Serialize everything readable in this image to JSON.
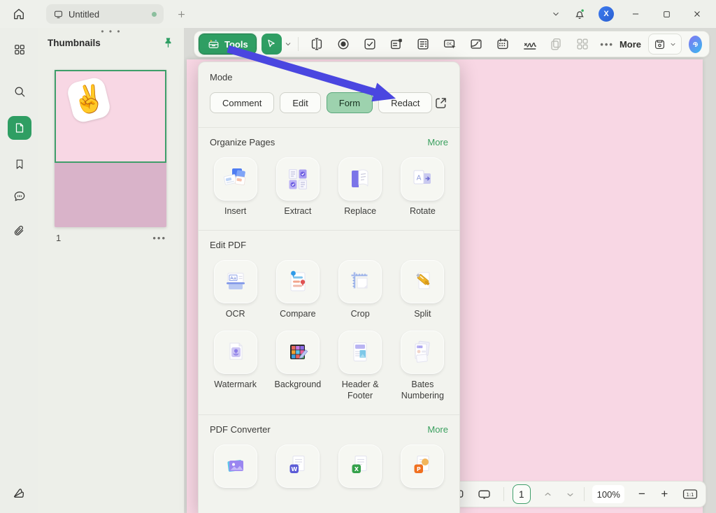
{
  "window": {
    "tab_title": "Untitled",
    "avatar_initial": "X"
  },
  "toolbar": {
    "tools_button_label": "Tools",
    "more_button_label": "More",
    "form_tools": [
      {
        "icon": "text-field-icon",
        "enabled": true
      },
      {
        "icon": "radio-button-icon",
        "enabled": true
      },
      {
        "icon": "checkbox-icon",
        "enabled": true
      },
      {
        "icon": "combo-box-icon",
        "enabled": true
      },
      {
        "icon": "list-box-icon",
        "enabled": true
      },
      {
        "icon": "push-button-icon",
        "enabled": true
      },
      {
        "icon": "image-field-icon",
        "enabled": true
      },
      {
        "icon": "date-field-icon",
        "enabled": true
      },
      {
        "icon": "signature-field-icon",
        "enabled": true
      },
      {
        "icon": "copy-icon",
        "enabled": false
      },
      {
        "icon": "grid-layout-icon",
        "enabled": false
      }
    ]
  },
  "sidebar": {
    "items": [
      {
        "icon": "grid-view-icon",
        "active": false
      },
      {
        "icon": "search-icon",
        "active": false
      },
      {
        "icon": "thumbnails-icon",
        "active": true
      },
      {
        "icon": "bookmark-icon",
        "active": false
      },
      {
        "icon": "comment-icon",
        "active": false
      },
      {
        "icon": "attachment-icon",
        "active": false
      }
    ],
    "bottom_icon": "swatches-icon"
  },
  "thumbnails": {
    "title": "Thumbnails",
    "page_number": "1"
  },
  "panel": {
    "mode": {
      "label": "Mode",
      "buttons": [
        {
          "label": "Comment",
          "active": false
        },
        {
          "label": "Edit",
          "active": false
        },
        {
          "label": "Form",
          "active": true
        },
        {
          "label": "Redact",
          "active": false
        }
      ]
    },
    "sections": [
      {
        "title": "Organize Pages",
        "more_label": "More",
        "items": [
          {
            "label": "Insert",
            "icon": "insert-icon"
          },
          {
            "label": "Extract",
            "icon": "extract-icon"
          },
          {
            "label": "Replace",
            "icon": "replace-icon"
          },
          {
            "label": "Rotate",
            "icon": "rotate-icon"
          }
        ]
      },
      {
        "title": "Edit PDF",
        "more_label": "",
        "items": [
          {
            "label": "OCR",
            "icon": "ocr-icon"
          },
          {
            "label": "Compare",
            "icon": "compare-icon"
          },
          {
            "label": "Crop",
            "icon": "crop-icon"
          },
          {
            "label": "Split",
            "icon": "split-icon"
          },
          {
            "label": "Watermark",
            "icon": "watermark-icon"
          },
          {
            "label": "Background",
            "icon": "background-icon"
          },
          {
            "label": "Header & Footer",
            "icon": "header-footer-icon"
          },
          {
            "label": "Bates Numbering",
            "icon": "bates-numbering-icon"
          }
        ]
      },
      {
        "title": "PDF Converter",
        "more_label": "More",
        "items": [
          {
            "label": "",
            "icon": "pdf-to-image-icon"
          },
          {
            "label": "",
            "icon": "pdf-to-word-icon"
          },
          {
            "label": "",
            "icon": "pdf-to-excel-icon"
          },
          {
            "label": "",
            "icon": "pdf-to-ppt-icon"
          }
        ]
      }
    ]
  },
  "statusbar": {
    "page_number": "1",
    "zoom_level": "100%",
    "fit_label": "1:1"
  },
  "colors": {
    "accent_green": "#2f9e63",
    "form_active_bg": "#9dd2ae",
    "link_green": "#3ba05f",
    "page_pink": "#f8d7e4",
    "thumb_shade_pink": "#d9b3c9",
    "arrow_blue": "#4a46e0"
  }
}
